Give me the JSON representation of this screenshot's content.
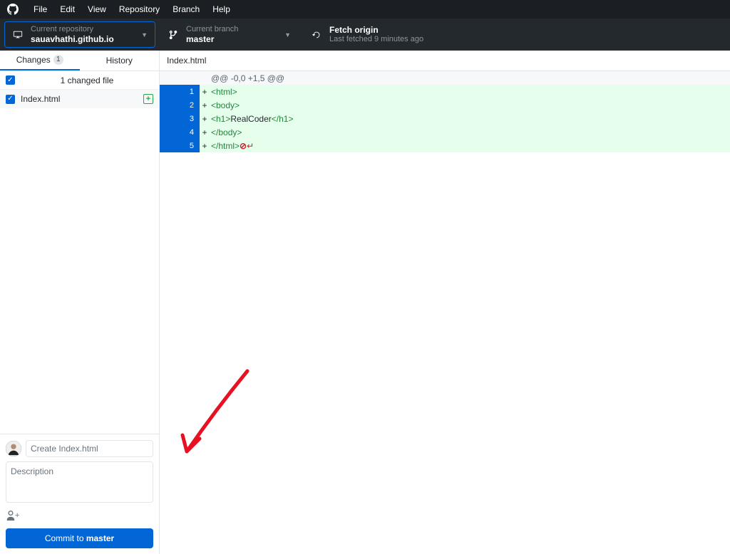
{
  "menubar": {
    "items": [
      "File",
      "Edit",
      "View",
      "Repository",
      "Branch",
      "Help"
    ]
  },
  "toolbar": {
    "repo": {
      "label": "Current repository",
      "value": "sauavhathi.github.io"
    },
    "branch": {
      "label": "Current branch",
      "value": "master"
    },
    "fetch": {
      "label": "Fetch origin",
      "sub": "Last fetched 9 minutes ago"
    }
  },
  "sidebar": {
    "tabs": {
      "changes": {
        "label": "Changes",
        "badge": "1"
      },
      "history": {
        "label": "History"
      }
    },
    "files_header": "1 changed file",
    "file": {
      "name": "Index.html"
    }
  },
  "commit": {
    "summary_placeholder": "Create Index.html",
    "description_placeholder": "Description",
    "button_prefix": "Commit to ",
    "button_branch": "master"
  },
  "diff": {
    "filename": "Index.html",
    "hunk": "@@ -0,0 +1,5 @@",
    "lines": [
      {
        "n": "1",
        "plus": "+",
        "parts": [
          {
            "t": "tag",
            "v": "<html>"
          }
        ]
      },
      {
        "n": "2",
        "plus": "+",
        "parts": [
          {
            "t": "tag",
            "v": "<body>"
          }
        ]
      },
      {
        "n": "3",
        "plus": "+",
        "parts": [
          {
            "t": "tag",
            "v": "<h1>"
          },
          {
            "t": "txt",
            "v": "RealCoder"
          },
          {
            "t": "tag",
            "v": "</h1>"
          }
        ]
      },
      {
        "n": "4",
        "plus": "+",
        "parts": [
          {
            "t": "tag",
            "v": "</body>"
          }
        ]
      },
      {
        "n": "5",
        "plus": "+",
        "parts": [
          {
            "t": "tag",
            "v": "</html>"
          }
        ],
        "eof": true
      }
    ]
  }
}
